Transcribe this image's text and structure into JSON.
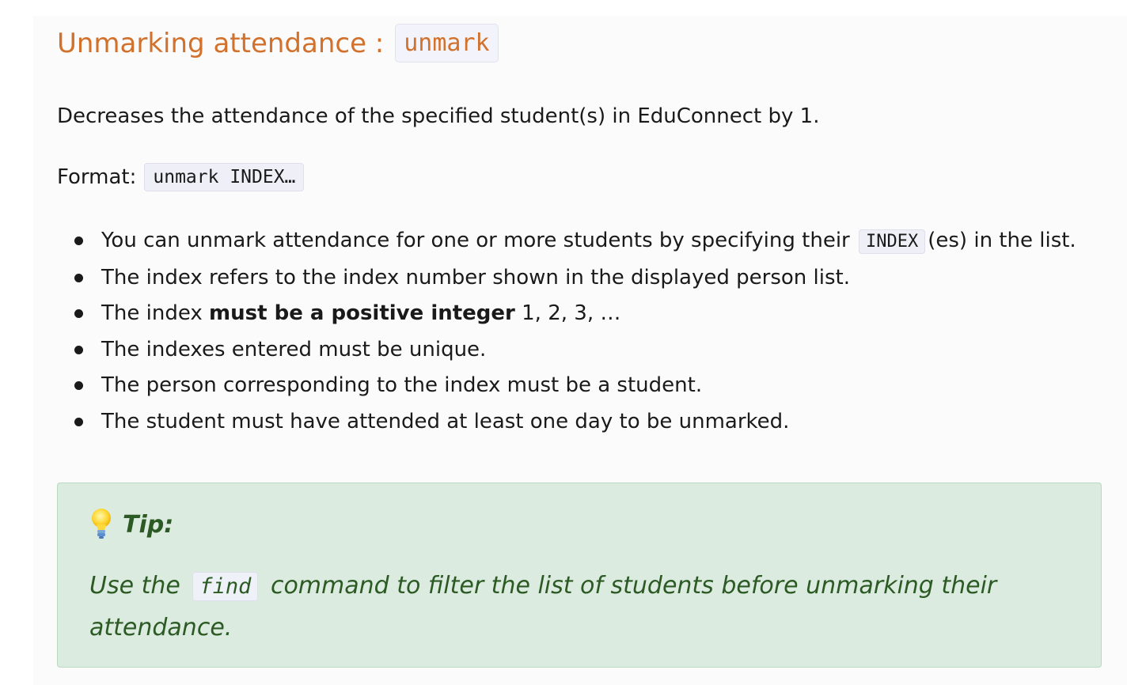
{
  "section": {
    "title_text": "Unmarking attendance :",
    "title_code": "unmark",
    "description": "Decreases the attendance of the specified student(s) in EduConnect by 1.",
    "format_label": "Format:",
    "format_code": "unmark INDEX…"
  },
  "bullets": [
    {
      "before": "You can unmark attendance for one or more students by specifying their",
      "code": "INDEX",
      "after": "(es) in the list."
    },
    {
      "text": "The index refers to the index number shown in the displayed person list."
    },
    {
      "before": "The index ",
      "bold": "must be a positive integer",
      "after": " 1, 2, 3, …"
    },
    {
      "text": "The indexes entered must be unique."
    },
    {
      "text": "The person corresponding to the index must be a student."
    },
    {
      "text": "The student must have attended at least one day to be unmarked."
    }
  ],
  "tip": {
    "icon": "lightbulb-icon",
    "title": "Tip:",
    "text_before": "Use the",
    "code": "find",
    "text_after": "command to filter the list of students before unmarking their attendance."
  },
  "colors": {
    "heading": "#d2712b",
    "tip_background": "#dcebdf",
    "tip_text": "#2c5a24"
  }
}
